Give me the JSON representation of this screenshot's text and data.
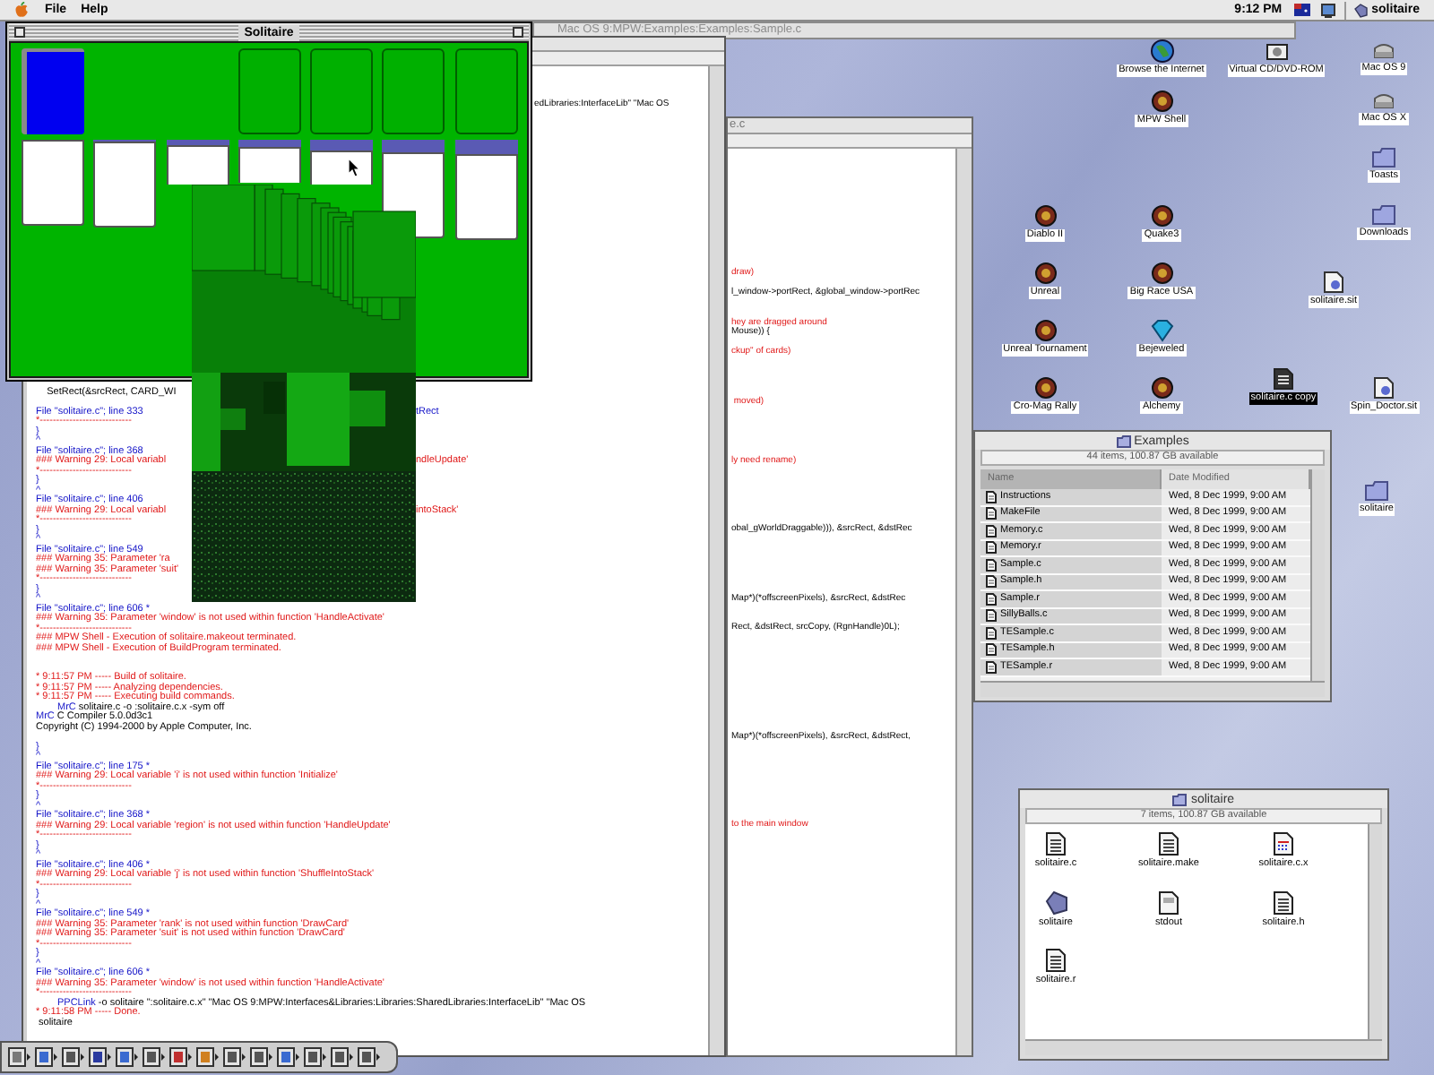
{
  "menu_bar": {
    "menus": [
      "File",
      "Help"
    ],
    "clock": "9:12 PM",
    "app_menu": "solitaire"
  },
  "background_window": {
    "title": "Mac OS 9:MPW:Examples:Examples:Sample.c"
  },
  "worksheet": {
    "top_fragment": "edLibraries:InterfaceLib\" \"Mac OS",
    "lines": [
      {
        "kind": "plain",
        "text": "    SetRect(&srcRect, CARD_WI"
      },
      {
        "kind": "blank"
      },
      {
        "kind": "file",
        "text": "File \"solitaire.c\"; line 333",
        "tail": "tRect"
      },
      {
        "kind": "warn",
        "text": "*----------------------------"
      },
      {
        "kind": "file",
        "text": "}"
      },
      {
        "kind": "file",
        "text": "^"
      },
      {
        "kind": "file",
        "text": "File \"solitaire.c\"; line 368"
      },
      {
        "kind": "warn",
        "text": "### Warning 29: Local variabl",
        "tail": "ndleUpdate'"
      },
      {
        "kind": "warn",
        "text": "*----------------------------"
      },
      {
        "kind": "file",
        "text": "}"
      },
      {
        "kind": "file",
        "text": "^"
      },
      {
        "kind": "file",
        "text": "File \"solitaire.c\"; line 406"
      },
      {
        "kind": "warn",
        "text": "### Warning 29: Local variabl",
        "tail": "intoStack'"
      },
      {
        "kind": "warn",
        "text": "*----------------------------"
      },
      {
        "kind": "file",
        "text": "}"
      },
      {
        "kind": "file",
        "text": "^"
      },
      {
        "kind": "file",
        "text": "File \"solitaire.c\"; line 549"
      },
      {
        "kind": "warn",
        "text": "### Warning 35: Parameter 'ra"
      },
      {
        "kind": "warn",
        "text": "### Warning 35: Parameter 'suit'"
      },
      {
        "kind": "warn",
        "text": "*----------------------------"
      },
      {
        "kind": "file",
        "text": "}"
      },
      {
        "kind": "file",
        "text": "^"
      },
      {
        "kind": "file",
        "text": "File \"solitaire.c\"; line 606 *"
      },
      {
        "kind": "warn",
        "text": "### Warning 35: Parameter 'window' is not used within function 'HandleActivate'"
      },
      {
        "kind": "warn",
        "text": "*----------------------------"
      },
      {
        "kind": "warn",
        "text": "### MPW Shell - Execution of solitaire.makeout terminated."
      },
      {
        "kind": "warn",
        "text": "### MPW Shell - Execution of BuildProgram terminated."
      },
      {
        "kind": "blank"
      },
      {
        "kind": "blank"
      },
      {
        "kind": "warn",
        "text": "* 9:11:57 PM ----- Build of solitaire."
      },
      {
        "kind": "warn",
        "text": "* 9:11:57 PM ----- Analyzing dependencies."
      },
      {
        "kind": "warn",
        "text": "* 9:11:57 PM ----- Executing build commands."
      },
      {
        "kind": "command",
        "tool": "MrC",
        "text": " solitaire.c -o :solitaire.c.x -sym off"
      },
      {
        "kind": "output",
        "tool": "MrC",
        "text": " C Compiler 5.0.0d3c1"
      },
      {
        "kind": "plain",
        "text": "Copyright (C) 1994-2000 by Apple Computer, Inc."
      },
      {
        "kind": "blank"
      },
      {
        "kind": "file",
        "text": "}"
      },
      {
        "kind": "file",
        "text": "^"
      },
      {
        "kind": "file",
        "text": "File \"solitaire.c\"; line 175 *"
      },
      {
        "kind": "warn",
        "text": "### Warning 29: Local variable 'i' is not used within function 'Initialize'"
      },
      {
        "kind": "warn",
        "text": "*----------------------------"
      },
      {
        "kind": "file",
        "text": "}"
      },
      {
        "kind": "file",
        "text": "^"
      },
      {
        "kind": "file",
        "text": "File \"solitaire.c\"; line 368 *"
      },
      {
        "kind": "warn",
        "text": "### Warning 29: Local variable 'region' is not used within function 'HandleUpdate'"
      },
      {
        "kind": "warn",
        "text": "*----------------------------"
      },
      {
        "kind": "file",
        "text": "}"
      },
      {
        "kind": "file",
        "text": "^"
      },
      {
        "kind": "file",
        "text": "File \"solitaire.c\"; line 406 *"
      },
      {
        "kind": "warn",
        "text": "### Warning 29: Local variable 'j' is not used within function 'ShuffleIntoStack'"
      },
      {
        "kind": "warn",
        "text": "*----------------------------"
      },
      {
        "kind": "file",
        "text": "}"
      },
      {
        "kind": "file",
        "text": "^"
      },
      {
        "kind": "file",
        "text": "File \"solitaire.c\"; line 549 *"
      },
      {
        "kind": "warn",
        "text": "### Warning 35: Parameter 'rank' is not used within function 'DrawCard'"
      },
      {
        "kind": "warn",
        "text": "### Warning 35: Parameter 'suit' is not used within function 'DrawCard'"
      },
      {
        "kind": "warn",
        "text": "*----------------------------"
      },
      {
        "kind": "file",
        "text": "}"
      },
      {
        "kind": "file",
        "text": "^"
      },
      {
        "kind": "file",
        "text": "File \"solitaire.c\"; line 606 *"
      },
      {
        "kind": "warn",
        "text": "### Warning 35: Parameter 'window' is not used within function 'HandleActivate'"
      },
      {
        "kind": "warn",
        "text": "*----------------------------"
      },
      {
        "kind": "command",
        "tool": "PPCLink",
        "text": " -o solitaire \":solitaire.c.x\" \"Mac OS 9:MPW:Interfaces&Libraries:Libraries:SharedLibraries:InterfaceLib\" \"Mac OS"
      },
      {
        "kind": "warn",
        "text": "* 9:11:58 PM ----- Done."
      },
      {
        "kind": "plain",
        "text": " solitaire"
      }
    ]
  },
  "code_window": {
    "title": "e.c",
    "lines": [
      {
        "kind": "blank"
      },
      {
        "kind": "blank"
      },
      {
        "kind": "blank"
      },
      {
        "kind": "blank"
      },
      {
        "kind": "blank"
      },
      {
        "kind": "blank"
      },
      {
        "kind": "blank"
      },
      {
        "kind": "blank"
      },
      {
        "kind": "blank"
      },
      {
        "kind": "blank"
      },
      {
        "kind": "blank"
      },
      {
        "kind": "blank"
      },
      {
        "kind": "comment",
        "text": "draw)"
      },
      {
        "kind": "blank"
      },
      {
        "kind": "code",
        "text": "l_window->portRect, &global_window->portRec"
      },
      {
        "kind": "blank"
      },
      {
        "kind": "blank"
      },
      {
        "kind": "comment",
        "text": "hey are dragged around"
      },
      {
        "kind": "code",
        "text": "Mouse)) {"
      },
      {
        "kind": "blank"
      },
      {
        "kind": "comment",
        "text": "ckup\" of cards)"
      },
      {
        "kind": "blank"
      },
      {
        "kind": "blank"
      },
      {
        "kind": "blank"
      },
      {
        "kind": "blank"
      },
      {
        "kind": "comment",
        "text": " moved)"
      },
      {
        "kind": "blank"
      },
      {
        "kind": "blank"
      },
      {
        "kind": "blank"
      },
      {
        "kind": "blank"
      },
      {
        "kind": "blank"
      },
      {
        "kind": "comment",
        "text": "ly need rename)"
      },
      {
        "kind": "blank"
      },
      {
        "kind": "blank"
      },
      {
        "kind": "blank"
      },
      {
        "kind": "blank"
      },
      {
        "kind": "blank"
      },
      {
        "kind": "blank"
      },
      {
        "kind": "code",
        "text": "obal_gWorldDraggable))), &srcRect, &dstRec"
      },
      {
        "kind": "blank"
      },
      {
        "kind": "blank"
      },
      {
        "kind": "blank"
      },
      {
        "kind": "blank"
      },
      {
        "kind": "blank"
      },
      {
        "kind": "blank"
      },
      {
        "kind": "code",
        "text": "Map*)(*offscreenPixels), &srcRect, &dstRec"
      },
      {
        "kind": "blank"
      },
      {
        "kind": "blank"
      },
      {
        "kind": "code",
        "text": "Rect, &dstRect, srcCopy, (RgnHandle)0L);"
      },
      {
        "kind": "blank"
      },
      {
        "kind": "blank"
      },
      {
        "kind": "blank"
      },
      {
        "kind": "blank"
      },
      {
        "kind": "blank"
      },
      {
        "kind": "blank"
      },
      {
        "kind": "blank"
      },
      {
        "kind": "blank"
      },
      {
        "kind": "blank"
      },
      {
        "kind": "blank"
      },
      {
        "kind": "code",
        "text": "Map*)(*offscreenPixels), &srcRect, &dstRect,"
      },
      {
        "kind": "blank"
      },
      {
        "kind": "blank"
      },
      {
        "kind": "blank"
      },
      {
        "kind": "blank"
      },
      {
        "kind": "blank"
      },
      {
        "kind": "blank"
      },
      {
        "kind": "blank"
      },
      {
        "kind": "blank"
      },
      {
        "kind": "comment",
        "text": "to the main window"
      }
    ]
  },
  "solitaire": {
    "title": "Solitaire",
    "stock": {
      "face_up": false
    },
    "foundations": [
      {
        "filled": false
      },
      {
        "filled": false
      },
      {
        "filled": false
      },
      {
        "filled": false
      }
    ],
    "tableau": [
      {
        "cards": [
          {
            "face_up": true
          }
        ]
      },
      {
        "cards": [
          {
            "face_up": false
          },
          {
            "face_up": true
          }
        ]
      },
      {
        "cards": [
          {
            "face_up": false
          },
          {
            "face_up": false
          },
          {
            "face_up": true
          }
        ]
      },
      {
        "cards": [
          {
            "face_up": false
          },
          {
            "face_up": false
          },
          {
            "face_up": false
          },
          {
            "face_up": true
          }
        ]
      },
      {
        "cards": [
          {
            "face_up": false
          },
          {
            "face_up": false
          },
          {
            "face_up": false
          },
          {
            "face_up": false
          },
          {
            "face_up": true
          }
        ]
      },
      {
        "cards": [
          {
            "face_up": false
          },
          {
            "face_up": false
          },
          {
            "face_up": false
          },
          {
            "face_up": false
          },
          {
            "face_up": false
          },
          {
            "face_up": true
          }
        ]
      },
      {
        "cards": [
          {
            "face_up": false
          },
          {
            "face_up": false
          },
          {
            "face_up": false
          },
          {
            "face_up": false
          },
          {
            "face_up": false
          },
          {
            "face_up": false
          },
          {
            "face_up": true
          }
        ]
      }
    ]
  },
  "desktop_icons": [
    {
      "label": "Browse the Internet",
      "kind": "globe",
      "selected": false
    },
    {
      "label": "Virtual CD/DVD-ROM",
      "kind": "disc",
      "selected": false
    },
    {
      "label": "Mac OS 9",
      "kind": "drive",
      "selected": false
    },
    {
      "label": "MPW Shell",
      "kind": "app",
      "selected": false
    },
    {
      "label": "Mac OS X",
      "kind": "drive",
      "selected": false
    },
    {
      "label": "Toasts",
      "kind": "folder",
      "selected": false
    },
    {
      "label": "Diablo II",
      "kind": "app",
      "selected": false
    },
    {
      "label": "Quake3",
      "kind": "app",
      "selected": false
    },
    {
      "label": "Downloads",
      "kind": "folder",
      "selected": false
    },
    {
      "label": "Unreal",
      "kind": "app",
      "selected": false
    },
    {
      "label": "Big Race USA",
      "kind": "app",
      "selected": false
    },
    {
      "label": "solitaire.sit",
      "kind": "archive",
      "selected": false
    },
    {
      "label": "Unreal Tournament",
      "kind": "app",
      "selected": false
    },
    {
      "label": "Bejeweled",
      "kind": "gem",
      "selected": false
    },
    {
      "label": "Cro-Mag Rally",
      "kind": "app",
      "selected": false
    },
    {
      "label": "Alchemy",
      "kind": "app",
      "selected": false
    },
    {
      "label": "solitaire.c copy",
      "kind": "document",
      "selected": true
    },
    {
      "label": "Spin_Doctor.sit",
      "kind": "archive",
      "selected": false
    },
    {
      "label": "solitaire",
      "kind": "folder",
      "selected": false
    }
  ],
  "examples_window": {
    "title": "Examples",
    "info": "44 items, 100.87 GB available",
    "columns": [
      {
        "label": "Name",
        "sorted": true
      },
      {
        "label": "Date Modified",
        "sorted": false
      }
    ],
    "rows": [
      {
        "name": "Instructions",
        "date": "Wed, 8 Dec 1999, 9:00 AM"
      },
      {
        "name": "MakeFile",
        "date": "Wed, 8 Dec 1999, 9:00 AM"
      },
      {
        "name": "Memory.c",
        "date": "Wed, 8 Dec 1999, 9:00 AM"
      },
      {
        "name": "Memory.r",
        "date": "Wed, 8 Dec 1999, 9:00 AM"
      },
      {
        "name": "Sample.c",
        "date": "Wed, 8 Dec 1999, 9:00 AM"
      },
      {
        "name": "Sample.h",
        "date": "Wed, 8 Dec 1999, 9:00 AM"
      },
      {
        "name": "Sample.r",
        "date": "Wed, 8 Dec 1999, 9:00 AM"
      },
      {
        "name": "SillyBalls.c",
        "date": "Wed, 8 Dec 1999, 9:00 AM"
      },
      {
        "name": "TESample.c",
        "date": "Wed, 8 Dec 1999, 9:00 AM"
      },
      {
        "name": "TESample.h",
        "date": "Wed, 8 Dec 1999, 9:00 AM"
      },
      {
        "name": "TESample.r",
        "date": "Wed, 8 Dec 1999, 9:00 AM"
      }
    ]
  },
  "solitaire_folder": {
    "title": "solitaire",
    "info": "7 items, 100.87 GB available",
    "items": [
      {
        "name": "solitaire.c",
        "kind": "document"
      },
      {
        "name": "solitaire.make",
        "kind": "document"
      },
      {
        "name": "solitaire.c.x",
        "kind": "object"
      },
      {
        "name": "solitaire",
        "kind": "application"
      },
      {
        "name": "stdout",
        "kind": "text"
      },
      {
        "name": "solitaire.h",
        "kind": "document"
      },
      {
        "name": "solitaire.r",
        "kind": "document"
      }
    ]
  }
}
